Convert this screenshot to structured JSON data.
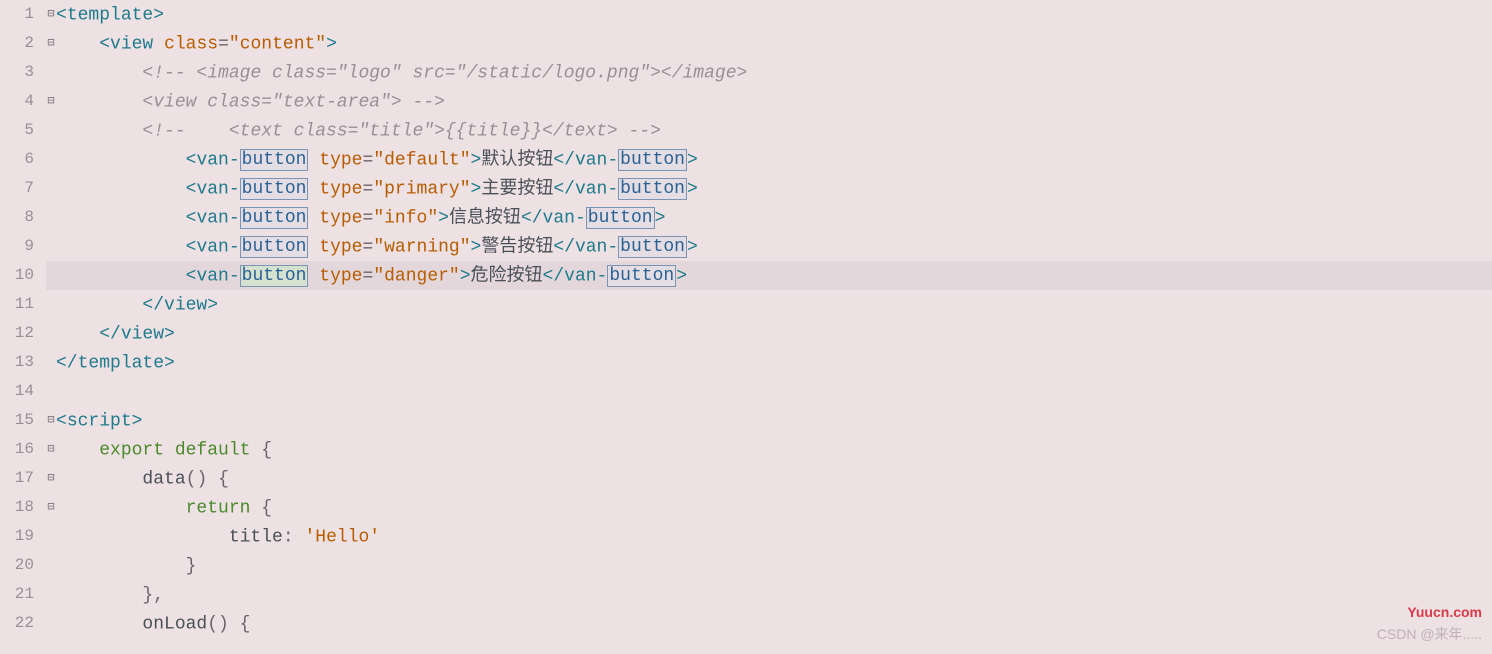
{
  "gutter": {
    "lines": [
      "1",
      "2",
      "3",
      "4",
      "5",
      "6",
      "7",
      "8",
      "9",
      "10",
      "11",
      "12",
      "13",
      "14",
      "15",
      "16",
      "17",
      "18",
      "19",
      "20",
      "21",
      "22"
    ],
    "fold_markers": {
      "1": "⊟",
      "2": "⊟",
      "4": "⊟",
      "15": "⊟",
      "16": "⊟",
      "17": "⊟",
      "18": "⊟"
    }
  },
  "tokens": {
    "lt": "<",
    "gt": ">",
    "lt_slash": "</",
    "eq": "=",
    "template": "template",
    "view": "view",
    "van": "van-",
    "button": "button",
    "script": "script",
    "attr_class": "class",
    "attr_type": "type",
    "val_content": "\"content\"",
    "val_default": "\"default\"",
    "val_primary": "\"primary\"",
    "val_info": "\"info\"",
    "val_warning": "\"warning\"",
    "val_danger": "\"danger\"",
    "txt_default": "默认按钮",
    "txt_primary": "主要按钮",
    "txt_info": "信息按钮",
    "txt_warning": "警告按钮",
    "txt_danger": "危险按钮",
    "comment1": "<!-- <image class=\"logo\" src=\"/static/logo.png\"></image>",
    "comment2": "<view class=\"text-area\"> -->",
    "comment3": "<!--    <text class=\"title\">{{title}}</text> -->",
    "kw_export": "export",
    "kw_default": "default",
    "kw_return": "return",
    "fn_data": "data",
    "fn_onload": "onLoad",
    "prop_title": "title",
    "val_hello": "'Hello'",
    "lbrace": "{",
    "rbrace": "}",
    "lparen": "(",
    "rparen": ")",
    "colon": ":",
    "comma": ","
  },
  "watermarks": {
    "w1": "Yuucn.com",
    "w2": "CSDN @来年....."
  }
}
